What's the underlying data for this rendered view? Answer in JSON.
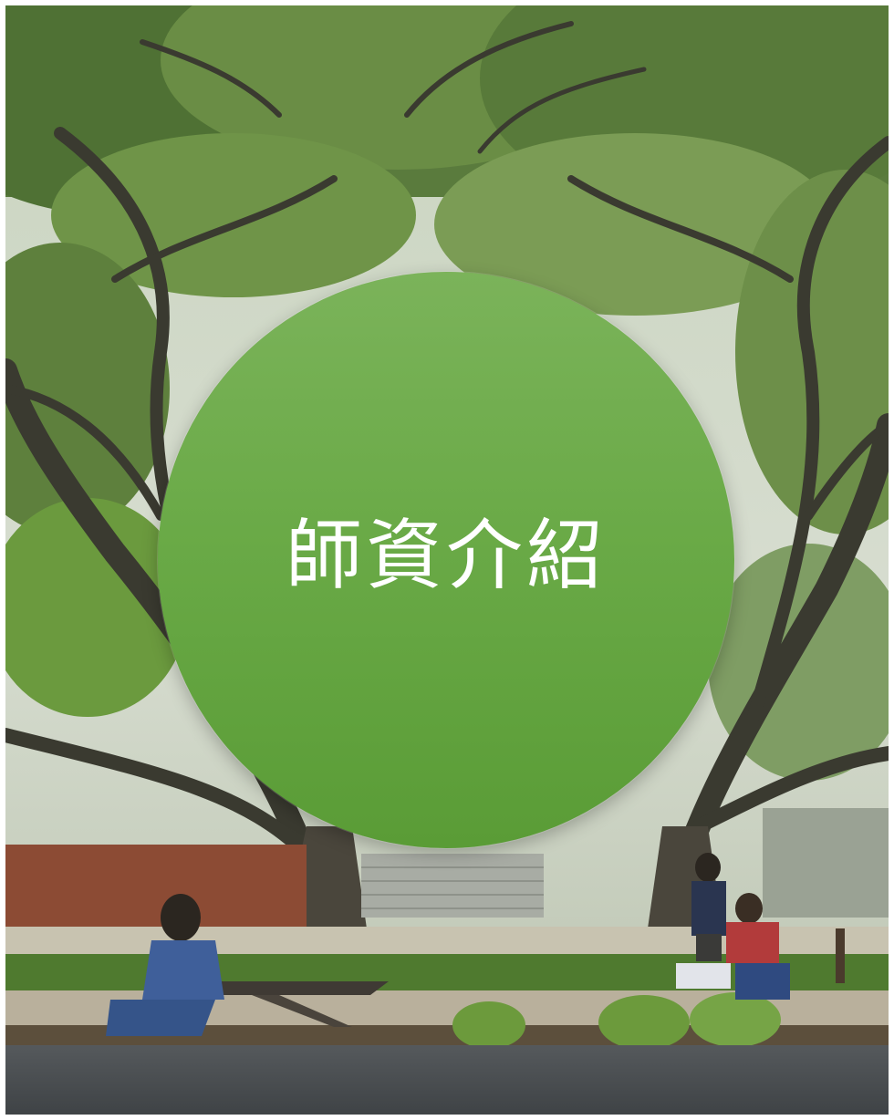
{
  "badge": {
    "title": "師資介紹",
    "color": "#6aaa47",
    "text_color": "#ffffff"
  },
  "photo": {
    "description_icon": "campus-trees-photo"
  }
}
